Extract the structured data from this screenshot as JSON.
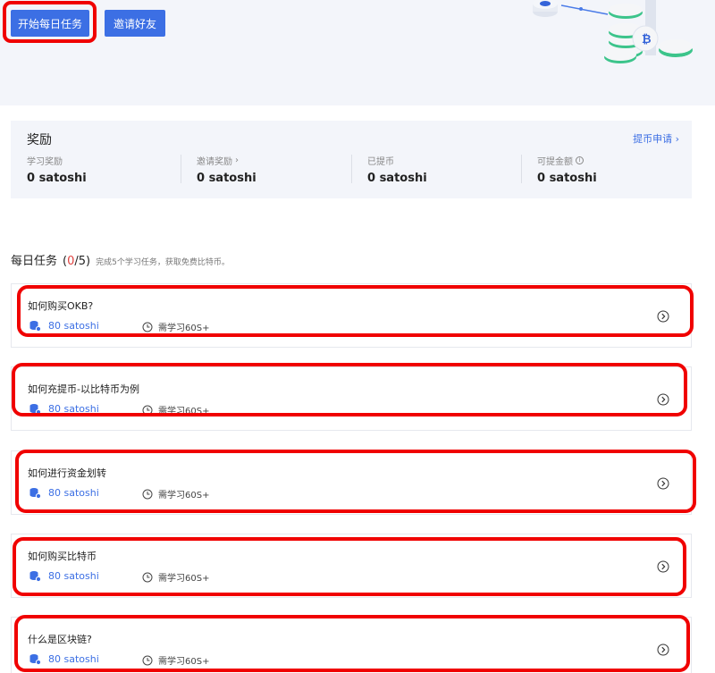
{
  "hero": {
    "start_button": "开始每日任务",
    "invite_button": "邀请好友"
  },
  "rewards": {
    "title": "奖励",
    "withdraw_link": "提币申请",
    "stats": [
      {
        "label": "学习奖励",
        "value": "0 satoshi"
      },
      {
        "label": "邀请奖励",
        "value": "0 satoshi"
      },
      {
        "label": "已提币",
        "value": "0 satoshi"
      },
      {
        "label": "可提金额",
        "value": "0 satoshi"
      }
    ]
  },
  "daily": {
    "title": "每日任务",
    "progress_open": "(",
    "progress_done": "0",
    "progress_rest": "/5)",
    "note": "完成5个学习任务，获取免费比特币。",
    "tasks": [
      {
        "title": "如何购买OKB?",
        "reward": "80 satoshi",
        "time": "需学习60S+"
      },
      {
        "title": "如何充提币-以比特币为例",
        "reward": "80 satoshi",
        "time": "需学习60S+"
      },
      {
        "title": "如何进行资金划转",
        "reward": "80 satoshi",
        "time": "需学习60S+"
      },
      {
        "title": "如何购买比特币",
        "reward": "80 satoshi",
        "time": "需学习60S+"
      },
      {
        "title": "什么是区块链?",
        "reward": "80 satoshi",
        "time": "需学习60S+"
      }
    ]
  },
  "colors": {
    "accent": "#3c6fe4",
    "highlight": "#f00000",
    "panel_bg": "#f3f5fa",
    "progress_done": "#e0413f"
  },
  "icons": [
    "coin-stack-icon",
    "clock-icon",
    "arrow-circle-right-icon",
    "chevron-right-icon",
    "info-icon"
  ]
}
